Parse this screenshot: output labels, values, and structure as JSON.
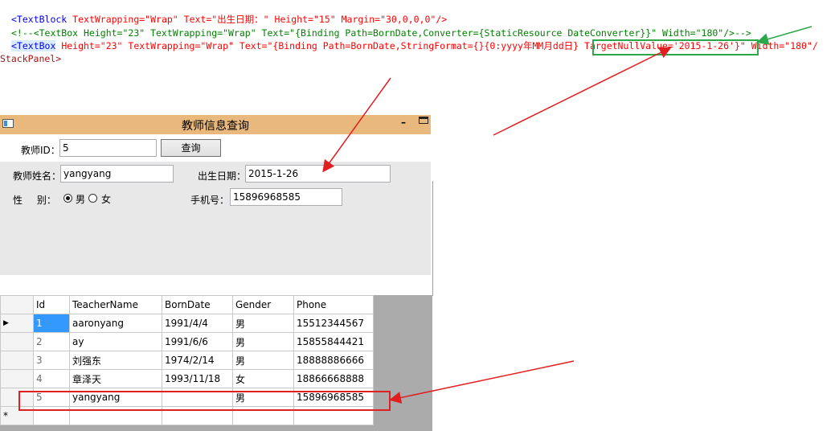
{
  "code": {
    "line1": {
      "open": "<TextBlock",
      "attrs": " TextWrapping=\"Wrap\" Text=\"出生日期：\" Height=\"15\" Margin=\"30,0,0,0\"/>"
    },
    "line2": "<!--<TextBox Height=\"23\" TextWrapping=\"Wrap\" Text=\"{Binding Path=BornDate,Converter={StaticResource DateConverter}}\" Width=\"180\"/>-->",
    "line3": {
      "open": "<TextBox",
      "part1": " Height=\"23\" TextWrapping=\"Wrap\" Text=\"{Binding Path=BornDate,StringFormat={}{0:yyyy年MM月dd日} ",
      "highlight": "TargetNullValue='2015-1-26'}",
      "part2": "\" Width=\"180\"/"
    },
    "line4": "StackPanel>"
  },
  "window": {
    "title": "教师信息查询",
    "teacher_id_label": "教师ID：",
    "teacher_id_value": "5",
    "query_button": "查询",
    "name_label": "教师姓名：",
    "name_value": "yangyang",
    "birth_label": "出生日期：",
    "birth_value": "2015-1-26",
    "gender_label": "性 别：",
    "gender_male": "男",
    "gender_female": "女",
    "phone_label": "手机号：",
    "phone_value": "15896968585"
  },
  "grid": {
    "columns": [
      "Id",
      "TeacherName",
      "BornDate",
      "Gender",
      "Phone"
    ],
    "rows": [
      [
        "1",
        "aaronyang",
        "1991/4/4",
        "男",
        "15512344567"
      ],
      [
        "2",
        "ay",
        "1991/6/6",
        "男",
        "15855844421"
      ],
      [
        "3",
        "刘强东",
        "1974/2/14",
        "男",
        "18888886666"
      ],
      [
        "4",
        "章泽天",
        "1993/11/18",
        "女",
        "18866668888"
      ],
      [
        "5",
        "yangyang",
        "",
        "男",
        "15896968585"
      ]
    ],
    "new_row_marker": "*",
    "current_row_marker": "▶"
  },
  "colors": {
    "titlebar": "#e8b87c",
    "arrow_red": "#e02020",
    "arrow_green": "#2aa84a",
    "selection": "#3399ff"
  }
}
